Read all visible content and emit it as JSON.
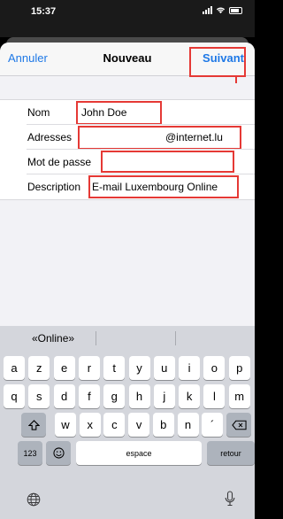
{
  "status": {
    "time": "15:37"
  },
  "nav": {
    "cancel": "Annuler",
    "title": "Nouveau",
    "next": "Suivant"
  },
  "form": {
    "name_label": "Nom",
    "name_value": "John Doe",
    "address_label": "Adresses",
    "address_value": "@internet.lu",
    "password_label": "Mot de passe",
    "password_value": "",
    "description_label": "Description",
    "description_value": "E-mail Luxembourg Online"
  },
  "keyboard": {
    "suggestion": "«Online»",
    "row1": [
      "a",
      "z",
      "e",
      "r",
      "t",
      "y",
      "u",
      "i",
      "o",
      "p"
    ],
    "row2": [
      "q",
      "s",
      "d",
      "f",
      "g",
      "h",
      "j",
      "k",
      "l",
      "m"
    ],
    "row3": [
      "w",
      "x",
      "c",
      "v",
      "b",
      "n",
      "´"
    ],
    "numbers_key": "123",
    "space_key": "espace",
    "return_key": "retour",
    "icons": {
      "shift": "shift-icon",
      "delete": "delete-icon",
      "emoji": "emoji-icon",
      "globe": "globe-icon",
      "mic": "microphone-icon"
    }
  },
  "colors": {
    "accent": "#1e78e6",
    "highlight": "#e53935"
  }
}
